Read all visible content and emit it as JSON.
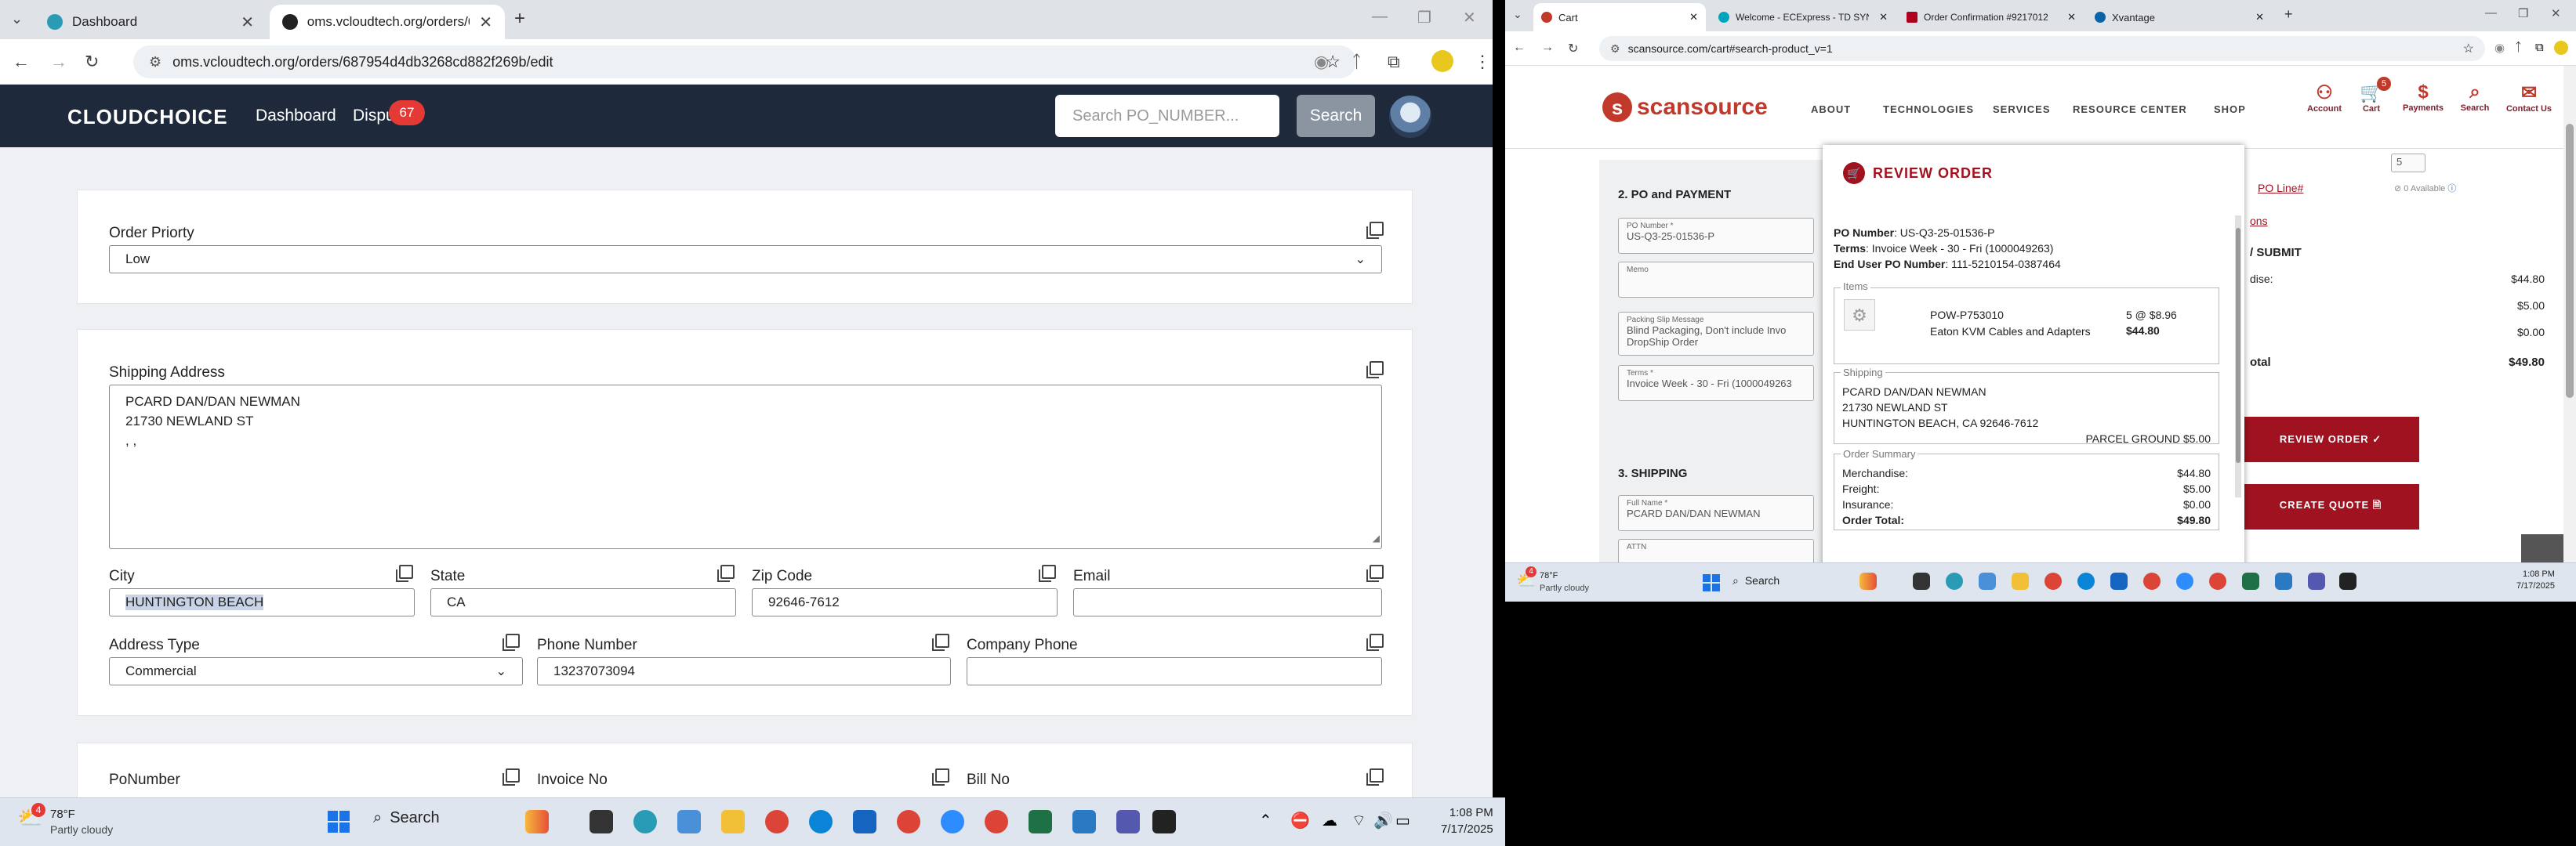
{
  "left": {
    "tabs": [
      {
        "title": "Dashboard"
      },
      {
        "title": "oms.vcloudtech.org/orders/687"
      }
    ],
    "address": "oms.vcloudtech.org/orders/687954d4db3268cd882f269b/edit",
    "app": {
      "logo": "CLOUDCHOICE",
      "nav_dashboard": "Dashboard",
      "nav_disputes": "Dispu",
      "disputes_count": "67",
      "search_placeholder": "Search PO_NUMBER...",
      "search_button": "Search"
    },
    "form": {
      "order_priority_label": "Order Priorty",
      "order_priority_value": "Low",
      "shipping_address_label": "Shipping Address",
      "shipping_address_lines": [
        "PCARD DAN/DAN NEWMAN",
        "21730 NEWLAND ST",
        ", ,"
      ],
      "city_label": "City",
      "city_value": "HUNTINGTON BEACH",
      "state_label": "State",
      "state_value": "CA",
      "zip_label": "Zip Code",
      "zip_value": "92646-7612",
      "email_label": "Email",
      "email_value": "",
      "address_type_label": "Address Type",
      "address_type_value": "Commercial",
      "phone_label": "Phone Number",
      "phone_value": "13237073094",
      "company_phone_label": "Company Phone",
      "company_phone_value": "",
      "po_label": "PoNumber",
      "invoice_label": "Invoice No",
      "bill_label": "Bill No"
    },
    "taskbar": {
      "weather_temp": "78°F",
      "weather_desc": "Partly cloudy",
      "weather_badge": "4",
      "search": "Search",
      "time": "1:08 PM",
      "date": "7/17/2025"
    }
  },
  "right": {
    "tabs": [
      {
        "title": "Cart"
      },
      {
        "title": "Welcome - ECExpress - TD SYN"
      },
      {
        "title": "Order Confirmation #9217012"
      },
      {
        "title": "Xvantage"
      }
    ],
    "address": "scansource.com/cart#search-product_v=1",
    "site": {
      "logo": "scansource",
      "nav": [
        "ABOUT",
        "TECHNOLOGIES",
        "SERVICES",
        "RESOURCE CENTER",
        "SHOP"
      ],
      "icons": [
        "Account",
        "Cart",
        "Payments",
        "Search",
        "Contact Us"
      ],
      "cart_count": "5",
      "section_po": "2. PO and PAYMENT",
      "po_number_label": "PO Number *",
      "po_number_value": "US-Q3-25-01536-P",
      "memo_label": "Memo",
      "packing_label": "Packing Slip Message",
      "packing_value_1": "Blind Packaging, Don't include Invo",
      "packing_value_2": "DropShip Order",
      "terms_label": "Terms *",
      "terms_value": "Invoice Week - 30 - Fri (1000049263",
      "section_shipping": "3. SHIPPING",
      "fullname_label": "Full Name *",
      "fullname_value": "PCARD DAN/DAN NEWMAN",
      "attn_label": "ATTN",
      "qty_value": "5",
      "available": "0 Available",
      "po_line": "PO Line#",
      "options_link": "ons",
      "submit_title": "/ SUBMIT",
      "merch_label": "dise:",
      "merch_value": "$44.80",
      "freight_value": "$5.00",
      "insurance_value": "$0.00",
      "total_label": "otal",
      "total_value": "$49.80",
      "review_button": "REVIEW ORDER ✓",
      "quote_button": "CREATE QUOTE 🗎"
    },
    "modal": {
      "title": "REVIEW ORDER",
      "po_number_label": "PO Number",
      "po_number_value": "US-Q3-25-01536-P",
      "terms_label": "Terms",
      "terms_value": "Invoice Week - 30 - Fri (1000049263)",
      "enduser_label": "End User PO Number",
      "enduser_value": "111-5210154-0387464",
      "items_legend": "Items",
      "item_sku": "POW-P753010",
      "item_desc": "Eaton KVM Cables and Adapters",
      "item_qty": "5 @ $8.96",
      "item_total": "$44.80",
      "shipping_legend": "Shipping",
      "ship_lines": [
        "PCARD DAN/DAN NEWMAN",
        "21730 NEWLAND ST",
        "HUNTINGTON BEACH, CA 92646-7612"
      ],
      "ship_method": "PARCEL GROUND $5.00",
      "summary_legend": "Order Summary",
      "summary": [
        {
          "label": "Merchandise:",
          "value": "$44.80"
        },
        {
          "label": "Freight:",
          "value": "$5.00"
        },
        {
          "label": "Insurance:",
          "value": "$0.00"
        },
        {
          "label": "Order Total:",
          "value": "$49.80"
        }
      ]
    },
    "taskbar": {
      "weather_temp": "78°F",
      "weather_desc": "Partly cloudy",
      "weather_badge": "4",
      "search": "Search",
      "time": "1:08 PM",
      "date": "7/17/2025"
    }
  },
  "colors": {
    "app_nav": "#1e2a3b",
    "badge": "#e53935",
    "scansource_red": "#a0121f"
  }
}
